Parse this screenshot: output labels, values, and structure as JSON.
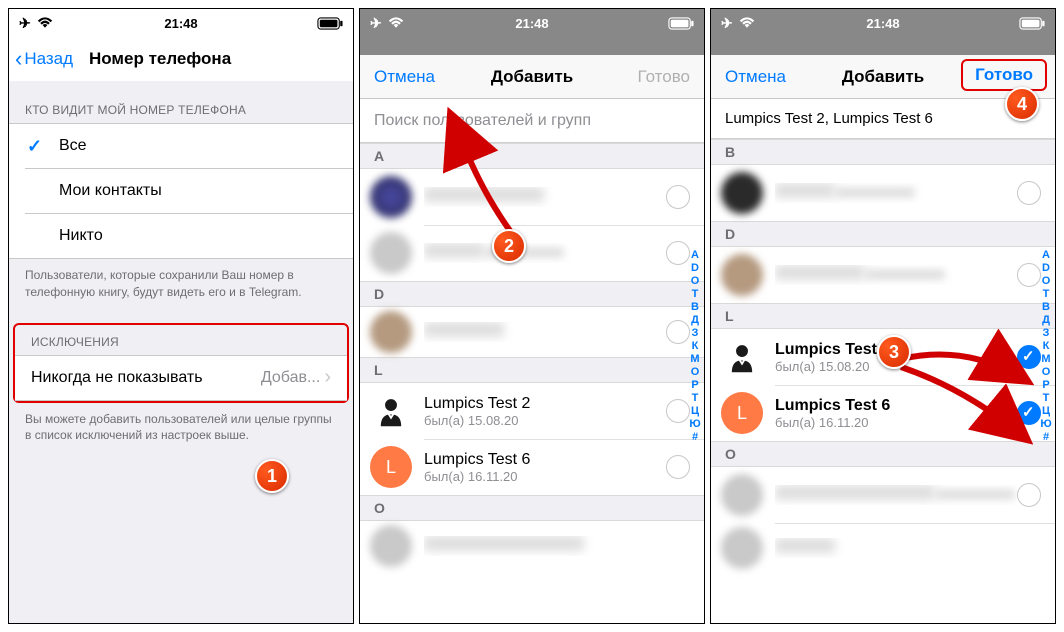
{
  "statusbar": {
    "time": "21:48"
  },
  "screen1": {
    "back": "Назад",
    "title": "Номер телефона",
    "section_who": "КТО ВИДИТ МОЙ НОМЕР ТЕЛЕФОНА",
    "opt_all": "Все",
    "opt_contacts": "Мои контакты",
    "opt_nobody": "Никто",
    "footer_who": "Пользователи, которые сохранили Ваш номер в телефонную книгу, будут видеть его и в Telegram.",
    "section_exceptions": "ИСКЛЮЧЕНИЯ",
    "never_show": "Никогда не показывать",
    "never_show_detail": "Добав...",
    "footer_exceptions": "Вы можете добавить пользователей или целые группы в список исключений из настроек выше."
  },
  "screen2": {
    "cancel": "Отмена",
    "title": "Добавить",
    "done": "Готово",
    "search_placeholder": "Поиск пользователей и групп",
    "sections": {
      "A": "A",
      "D": "D",
      "L": "L",
      "O": "O"
    },
    "contacts": {
      "lt2_name": "Lumpics Test 2",
      "lt2_sub": "был(а) 15.08.20",
      "lt6_name": "Lumpics Test 6",
      "lt6_sub": "был(а) 16.11.20",
      "L_initial": "L"
    },
    "index": [
      "A",
      "D",
      "O",
      "Т",
      "В",
      "Д",
      "З",
      "К",
      "М",
      "О",
      "Р",
      "Т",
      "Ц",
      "Ю",
      "#"
    ]
  },
  "screen3": {
    "cancel": "Отмена",
    "title": "Добавить",
    "done": "Готово",
    "selected": "Lumpics Test 2,  Lumpics Test 6",
    "sections": {
      "B": "B",
      "D": "D",
      "L": "L",
      "O": "O"
    },
    "contacts": {
      "lt2_name": "Lumpics Test 2",
      "lt2_sub": "был(а) 15.08.20",
      "lt6_name": "Lumpics Test 6",
      "lt6_sub": "был(а) 16.11.20",
      "L_initial": "L"
    },
    "index": [
      "A",
      "D",
      "O",
      "Т",
      "В",
      "Д",
      "З",
      "К",
      "М",
      "О",
      "Р",
      "Т",
      "Ц",
      "Ю",
      "#"
    ]
  },
  "markers": {
    "m1": "1",
    "m2": "2",
    "m3": "3",
    "m4": "4"
  }
}
